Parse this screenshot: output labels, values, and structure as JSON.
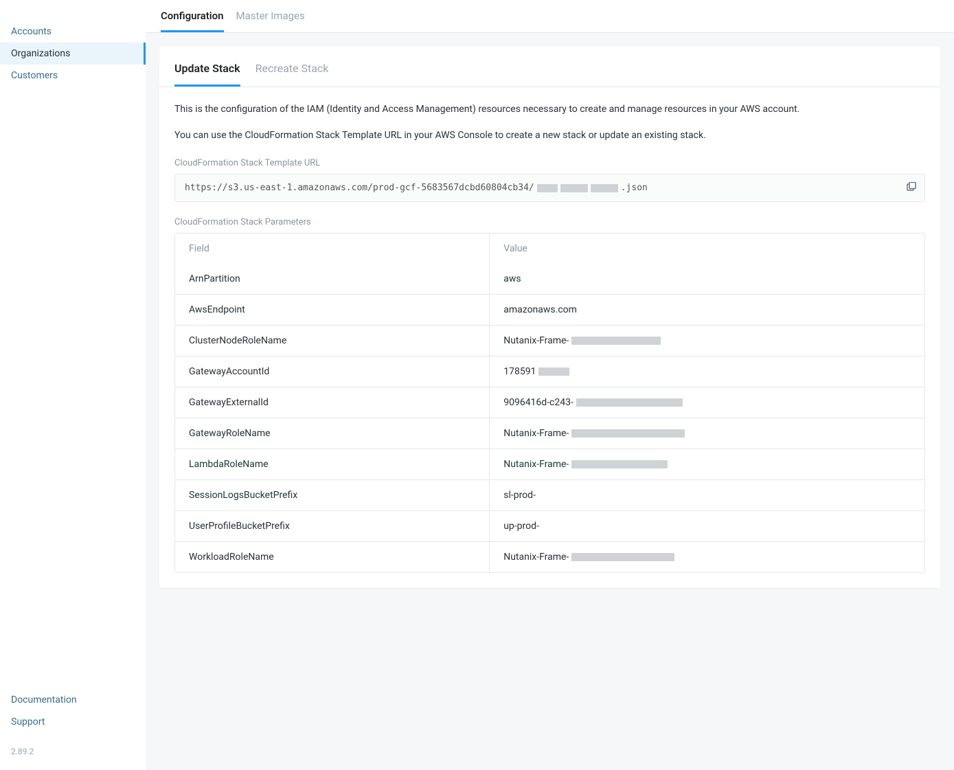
{
  "sidebar": {
    "items": [
      {
        "label": "Accounts",
        "active": false
      },
      {
        "label": "Organizations",
        "active": true
      },
      {
        "label": "Customers",
        "active": false
      }
    ],
    "footer": [
      {
        "label": "Documentation"
      },
      {
        "label": "Support"
      }
    ],
    "version": "2.89.2"
  },
  "topTabs": [
    {
      "label": "Configuration",
      "active": true
    },
    {
      "label": "Master Images",
      "active": false
    }
  ],
  "cardTabs": [
    {
      "label": "Update Stack",
      "active": true
    },
    {
      "label": "Recreate Stack",
      "active": false
    }
  ],
  "description": {
    "p1": "This is the configuration of the IAM (Identity and Access Management) resources necessary to create and manage resources in your AWS account.",
    "p2": "You can use the CloudFormation Stack Template URL in your AWS Console to create a new stack or update an existing stack."
  },
  "urlSection": {
    "label": "CloudFormation Stack Template URL",
    "prefix": "https://s3.us-east-1.amazonaws.com/prod-gcf-5683567dcbd60804cb34/",
    "suffix": ".json"
  },
  "paramsLabel": "CloudFormation Stack Parameters",
  "paramsHeader": {
    "field": "Field",
    "value": "Value"
  },
  "params": [
    {
      "field": "ArnPartition",
      "value": "aws",
      "redacted": false
    },
    {
      "field": "AwsEndpoint",
      "value": "amazonaws.com",
      "redacted": false
    },
    {
      "field": "ClusterNodeRoleName",
      "value": "Nutanix-Frame-",
      "redacted": true,
      "rw": 130
    },
    {
      "field": "GatewayAccountId",
      "value": "178591",
      "redacted": true,
      "rw": 45
    },
    {
      "field": "GatewayExternalId",
      "value": "9096416d-c243-",
      "redacted": true,
      "rw": 155
    },
    {
      "field": "GatewayRoleName",
      "value": "Nutanix-Frame-",
      "redacted": true,
      "rw": 165
    },
    {
      "field": "LambdaRoleName",
      "value": "Nutanix-Frame-",
      "redacted": true,
      "rw": 140
    },
    {
      "field": "SessionLogsBucketPrefix",
      "value": "sl-prod-",
      "redacted": false
    },
    {
      "field": "UserProfileBucketPrefix",
      "value": "up-prod-",
      "redacted": false
    },
    {
      "field": "WorkloadRoleName",
      "value": "Nutanix-Frame-",
      "redacted": true,
      "rw": 150
    }
  ]
}
